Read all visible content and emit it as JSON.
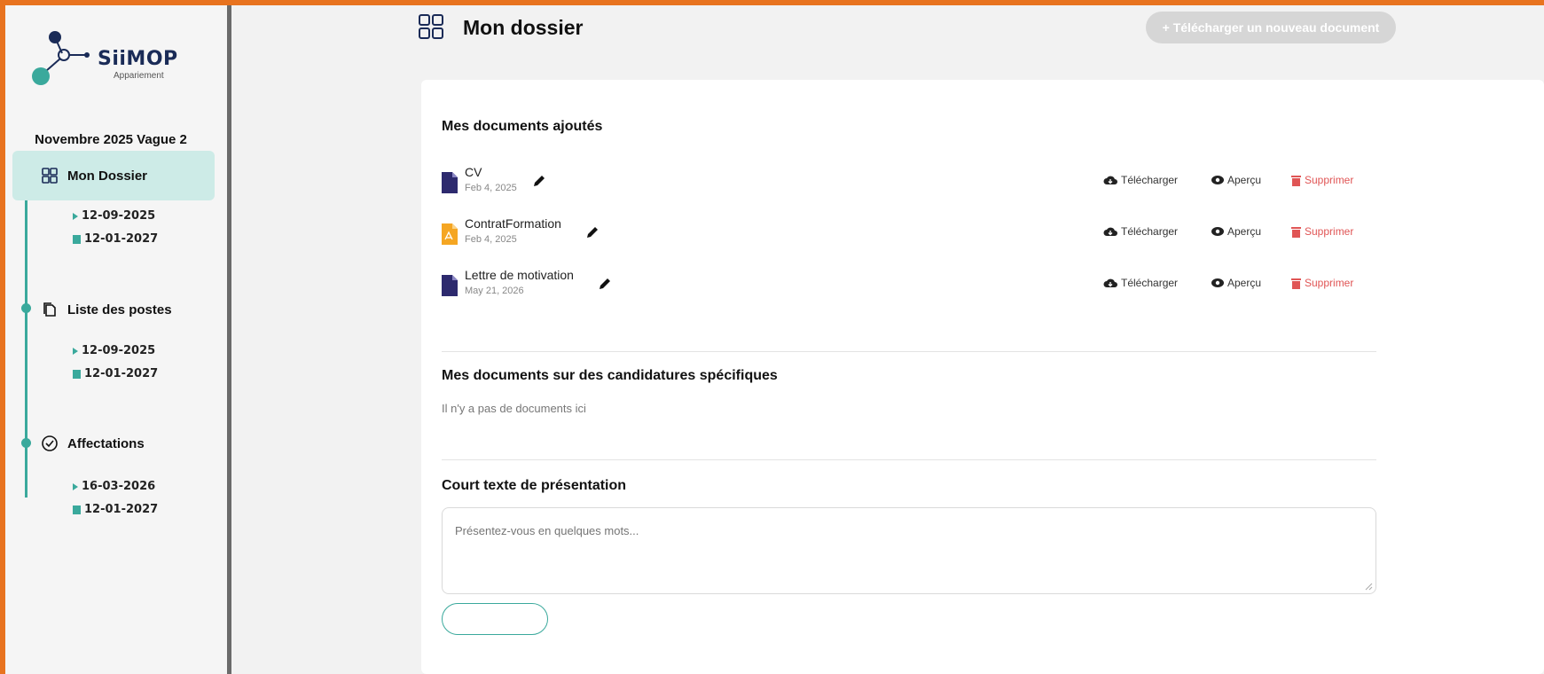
{
  "brand": {
    "name": "SiiMOP",
    "subtitle": "Appariement"
  },
  "sidebar": {
    "wave": "Novembre 2025 Vague 2",
    "items": [
      {
        "label": "Mon Dossier",
        "icon": "grid-icon",
        "start": "12-09-2025",
        "end": "12-01-2027",
        "active": true
      },
      {
        "label": "Liste des postes",
        "icon": "copy-icon",
        "start": "12-09-2025",
        "end": "12-01-2027",
        "active": false
      },
      {
        "label": "Affectations",
        "icon": "check-circle-icon",
        "start": "16-03-2026",
        "end": "12-01-2027",
        "active": false
      }
    ]
  },
  "header": {
    "title": "Mon dossier",
    "upload_label": "+ Télécharger un nouveau document"
  },
  "documents": {
    "title": "Mes documents ajoutés",
    "rows": [
      {
        "name": "CV",
        "date": "Feb 4, 2025",
        "type": "doc"
      },
      {
        "name": "ContratFormation",
        "date": "Feb 4, 2025",
        "type": "pdf"
      },
      {
        "name": "Lettre de motivation",
        "date": "May 21, 2026",
        "type": "doc"
      }
    ],
    "actions": {
      "download": "Télécharger",
      "preview": "Aperçu",
      "delete": "Supprimer"
    }
  },
  "specific": {
    "title": "Mes documents sur des candidatures spécifiques",
    "empty": "Il n'y a pas de documents ici"
  },
  "presentation": {
    "title": "Court texte de présentation",
    "placeholder": "Présentez-vous en quelques mots..."
  },
  "colors": {
    "accent": "#3aa99c",
    "active_bg": "#cdebe7",
    "danger": "#e05555",
    "frame": "#e8731f",
    "doc_icon": "#2d2a6e",
    "pdf_icon": "#f5a623"
  }
}
